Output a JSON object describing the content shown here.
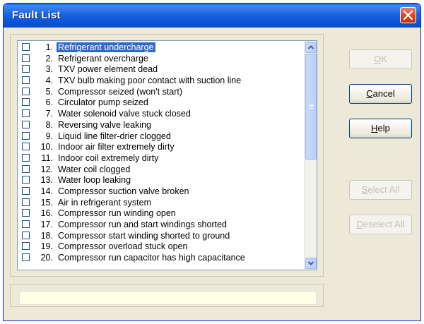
{
  "window": {
    "title": "Fault List"
  },
  "faults": [
    {
      "num": "1.",
      "label": "Refrigerant undercharge",
      "selected": true
    },
    {
      "num": "2.",
      "label": "Refrigerant overcharge"
    },
    {
      "num": "3.",
      "label": "TXV power element dead"
    },
    {
      "num": "4.",
      "label": "TXV bulb making poor contact with suction line"
    },
    {
      "num": "5.",
      "label": "Compressor seized (won't start)"
    },
    {
      "num": "6.",
      "label": "Circulator pump seized"
    },
    {
      "num": "7.",
      "label": "Water solenoid valve stuck closed"
    },
    {
      "num": "8.",
      "label": "Reversing valve leaking"
    },
    {
      "num": "9.",
      "label": "Liquid line filter-drier clogged"
    },
    {
      "num": "10.",
      "label": "Indoor air filter extremely dirty"
    },
    {
      "num": "11.",
      "label": "Indoor coil extremely dirty"
    },
    {
      "num": "12.",
      "label": "Water coil clogged"
    },
    {
      "num": "13.",
      "label": "Water loop leaking"
    },
    {
      "num": "14.",
      "label": "Compressor suction valve broken"
    },
    {
      "num": "15.",
      "label": "Air in refrigerant system"
    },
    {
      "num": "16.",
      "label": "Compressor run winding open"
    },
    {
      "num": "17.",
      "label": "Compressor run and start windings shorted"
    },
    {
      "num": "18.",
      "label": "Compressor start winding shorted to ground"
    },
    {
      "num": "19.",
      "label": "Compressor overload stuck open"
    },
    {
      "num": "20.",
      "label": "Compressor run capacitor has high capacitance"
    }
  ],
  "buttons": {
    "ok": {
      "mnemonic": "O",
      "rest": "K"
    },
    "cancel": {
      "mnemonic": "C",
      "rest": "ancel"
    },
    "help": {
      "mnemonic": "H",
      "rest": "elp"
    },
    "select_all": {
      "mnemonic": "S",
      "rest": "elect All"
    },
    "deselect_all": {
      "mnemonic": "D",
      "rest": "eselect All"
    }
  },
  "status": {
    "text": ""
  },
  "colors": {
    "titlebar": "#0a5be6",
    "selection": "#316ac5",
    "face": "#ece9d8"
  }
}
